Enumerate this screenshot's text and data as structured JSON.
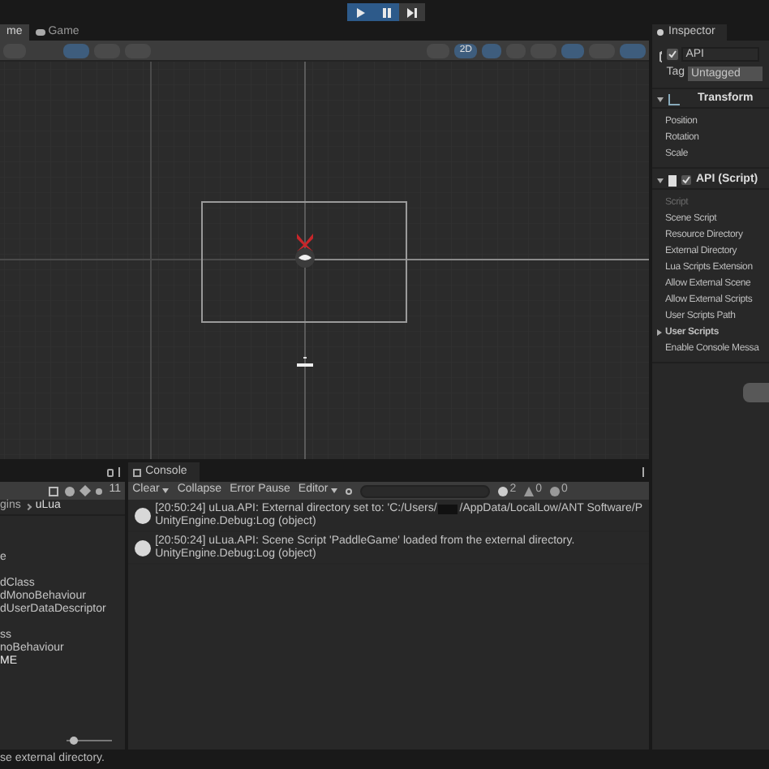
{
  "tabs": [
    {
      "label": "me",
      "selected": true
    },
    {
      "label": "Game",
      "selected": false
    }
  ],
  "scene_toolbar": {
    "mode_button": "2D",
    "mode_selected": true
  },
  "inspector": {
    "tab": "Inspector",
    "object": {
      "active": true,
      "name": "API",
      "tag_label": "Tag",
      "tag": "Untagged"
    },
    "components": [
      {
        "title": "Transform",
        "kind": "transform",
        "fields": [
          {
            "label": "Position",
            "disabled": false,
            "kind": "field"
          },
          {
            "label": "Rotation",
            "disabled": false,
            "kind": "field"
          },
          {
            "label": "Scale",
            "disabled": false,
            "kind": "field"
          }
        ]
      },
      {
        "title": "API (Script)",
        "kind": "script",
        "enabled": true,
        "fields": [
          {
            "label": "Script",
            "disabled": true,
            "kind": "field"
          },
          {
            "label": "Scene Script",
            "disabled": false,
            "kind": "field"
          },
          {
            "label": "Resource Directory",
            "disabled": false,
            "kind": "field"
          },
          {
            "label": "External Directory",
            "disabled": false,
            "kind": "field"
          },
          {
            "label": "Lua Scripts Extension",
            "disabled": false,
            "kind": "field"
          },
          {
            "label": "Allow External Scene",
            "disabled": false,
            "kind": "field"
          },
          {
            "label": "Allow External Scripts",
            "disabled": false,
            "kind": "field"
          },
          {
            "label": "User Scripts Path",
            "disabled": false,
            "kind": "field"
          },
          {
            "label": "User Scripts",
            "disabled": false,
            "kind": "foldout"
          },
          {
            "label": "Enable Console Messa",
            "disabled": false,
            "kind": "field"
          }
        ]
      }
    ]
  },
  "project": {
    "hidden_count": "11",
    "breadcrumb": [
      "gins",
      "uLua"
    ],
    "items": [
      "e",
      "dClass",
      "dMonoBehaviour",
      "dUserDataDescriptor",
      "ss",
      "noBehaviour",
      "ME"
    ],
    "zoom_slider": {
      "level": 0.1
    }
  },
  "console": {
    "title": "Console",
    "toolbar": [
      {
        "label": "Clear",
        "dropdown": true
      },
      {
        "label": "Collapse",
        "dropdown": false
      },
      {
        "label": "Error Pause",
        "dropdown": false
      },
      {
        "label": "Editor",
        "dropdown": true
      }
    ],
    "counts": [
      {
        "kind": "info",
        "count": "2"
      },
      {
        "kind": "warning",
        "count": "0"
      },
      {
        "kind": "error",
        "count": "0"
      }
    ],
    "messages": [
      {
        "text": "[20:50:24] uLua.API: External directory set to: 'C:/Users/",
        "redacted": true,
        "text_after": "/AppData/LocalLow/ANT Software/P",
        "trace": "UnityEngine.Debug:Log (object)"
      },
      {
        "text": "[20:50:24] uLua.API: Scene Script 'PaddleGame' loaded from the external directory.",
        "redacted": false,
        "trace": "UnityEngine.Debug:Log (object)"
      }
    ]
  },
  "status_bar": "se external directory."
}
